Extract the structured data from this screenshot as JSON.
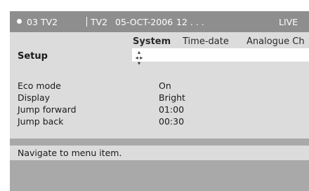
{
  "status": {
    "channel": "03 TV2",
    "source": "TV2",
    "date": "05-OCT-2006",
    "time": "12 . . .",
    "mode": "LIVE"
  },
  "menu": {
    "tabs": [
      {
        "label": "System",
        "active": true
      },
      {
        "label": "Time-date",
        "active": false
      },
      {
        "label": "Analogue Ch",
        "active": false
      }
    ],
    "title": "Setup",
    "nav_icon": "four-way-navigation-icon",
    "items": [
      {
        "label": "Eco mode",
        "value": "On"
      },
      {
        "label": "Display",
        "value": "Bright"
      },
      {
        "label": "Jump forward",
        "value": "01:00"
      },
      {
        "label": "Jump back",
        "value": "00:30"
      }
    ]
  },
  "help": {
    "text": "Navigate to menu item."
  },
  "colors": {
    "status_bar": "#8e8e8e",
    "panel": "#dcdcdc",
    "background": "#a9a9a9"
  }
}
